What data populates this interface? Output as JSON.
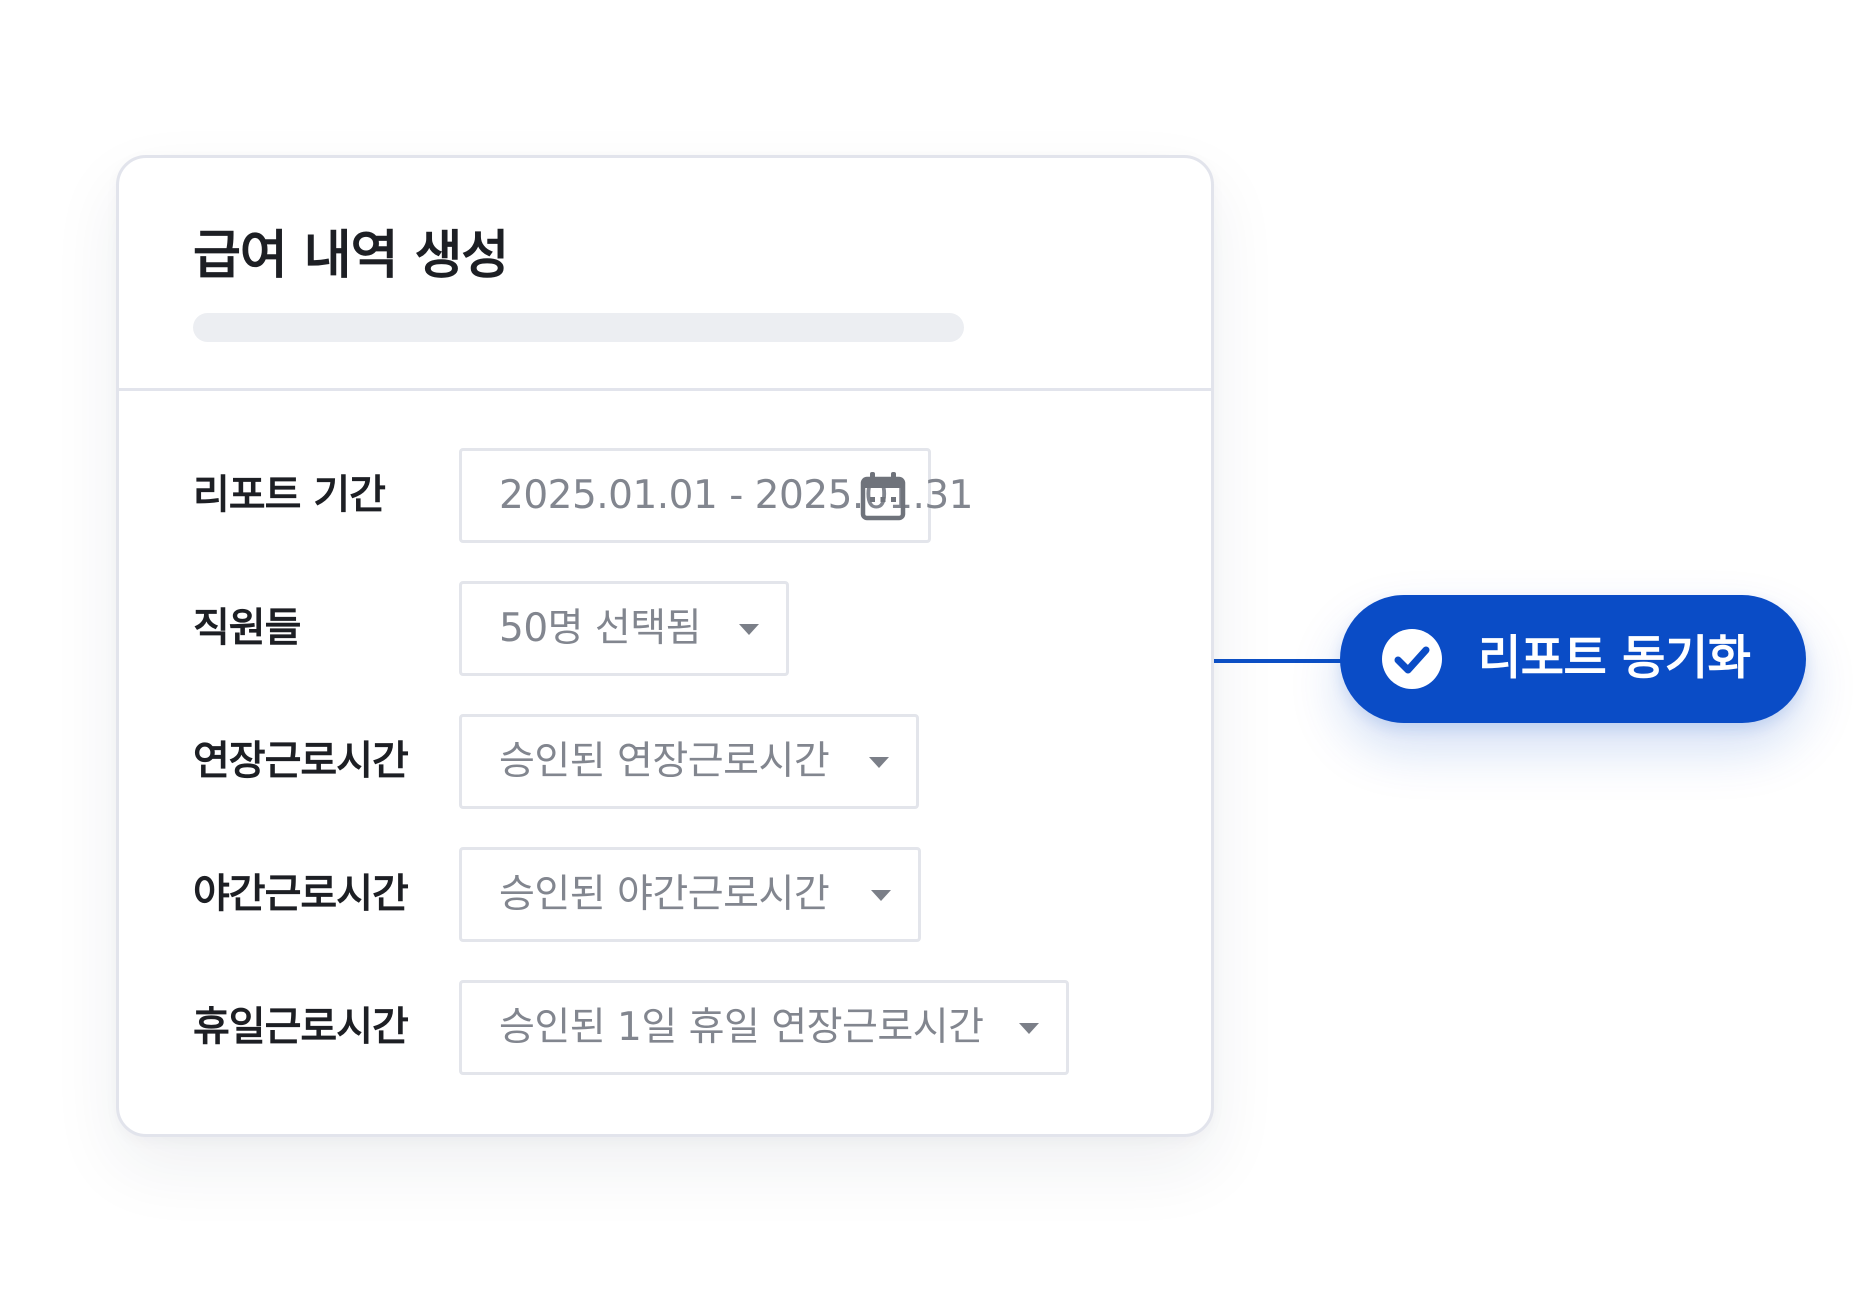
{
  "card": {
    "title": "급여 내역 생성"
  },
  "form": {
    "rows": [
      {
        "label": "리포트 기간",
        "value": "2025.01.01 - 2025.01.31",
        "control": "date-range",
        "icon": "calendar-icon"
      },
      {
        "label": "직원들",
        "value": "50명 선택됨",
        "control": "dropdown",
        "icon": "caret-down-icon"
      },
      {
        "label": "연장근로시간",
        "value": "승인된 연장근로시간",
        "control": "dropdown",
        "icon": "caret-down-icon"
      },
      {
        "label": "야간근로시간",
        "value": "승인된 야간근로시간",
        "control": "dropdown",
        "icon": "caret-down-icon"
      },
      {
        "label": "휴일근로시간",
        "value": "승인된 1일 휴일 연장근로시간",
        "control": "dropdown",
        "icon": "caret-down-icon"
      }
    ]
  },
  "sync_button": {
    "label": "리포트 동기화",
    "icon": "check-circle-icon"
  },
  "colors": {
    "accent": "#0A4CC6",
    "text": "#1D1F24",
    "muted_text": "#82868F",
    "border": "#E2E4EC",
    "placeholder_bar": "#ECEEF2"
  }
}
